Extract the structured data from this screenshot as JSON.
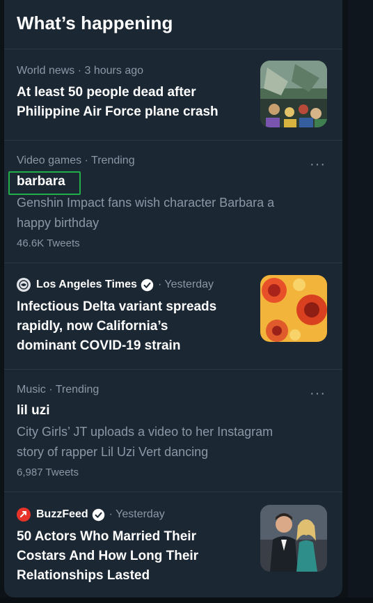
{
  "header": {
    "title": "What’s happening"
  },
  "items": [
    {
      "meta": "World news · 3 hours ago",
      "headline_lines": [
        "At least 50 people dead after",
        "Philippine Air Force plane crash"
      ]
    },
    {
      "meta": "Video games · Trending",
      "title": "barbara",
      "desc_lines": [
        "Genshin Impact fans wish character Barbara a",
        "happy birthday"
      ],
      "count": "46.6K Tweets",
      "more": "···"
    },
    {
      "source": "Los Angeles Times",
      "time": "· Yesterday",
      "headline_lines": [
        "Infectious Delta variant spreads",
        "rapidly, now California’s",
        "dominant COVID-19 strain"
      ]
    },
    {
      "meta": "Music · Trending",
      "title": "lil uzi",
      "desc_lines": [
        "City Girls’ JT uploads a video to her Instagram",
        "story of rapper Lil Uzi Vert dancing"
      ],
      "count": "6,987 Tweets",
      "more": "···"
    },
    {
      "source": "BuzzFeed",
      "time": "· Yesterday",
      "headline_lines": [
        "50 Actors Who Married Their",
        "Costars And How Long Their",
        "Relationships Lasted"
      ]
    }
  ],
  "colors": {
    "panel": "#1b2733",
    "secondary_text": "#8b98a5",
    "verified": "#1d9bf0",
    "highlight": "#1fae48"
  }
}
